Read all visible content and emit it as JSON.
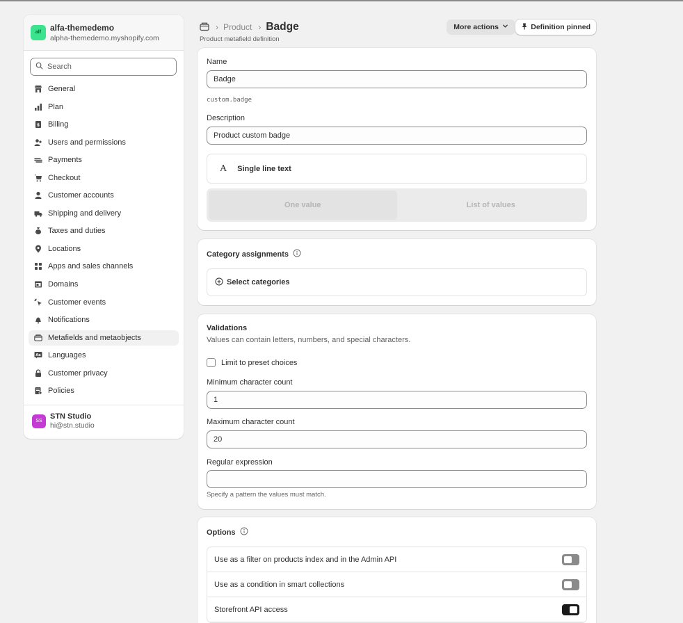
{
  "store": {
    "logo_text": "alf",
    "name": "alfa-themedemo",
    "domain": "alpha-themedemo.myshopify.com"
  },
  "search": {
    "placeholder": "Search"
  },
  "sidebar": {
    "items": [
      {
        "label": "General",
        "icon": "store-icon"
      },
      {
        "label": "Plan",
        "icon": "plan-icon"
      },
      {
        "label": "Billing",
        "icon": "billing-icon"
      },
      {
        "label": "Users and permissions",
        "icon": "users-icon"
      },
      {
        "label": "Payments",
        "icon": "payments-icon"
      },
      {
        "label": "Checkout",
        "icon": "cart-icon"
      },
      {
        "label": "Customer accounts",
        "icon": "person-icon"
      },
      {
        "label": "Shipping and delivery",
        "icon": "truck-icon"
      },
      {
        "label": "Taxes and duties",
        "icon": "tax-icon"
      },
      {
        "label": "Locations",
        "icon": "location-icon"
      },
      {
        "label": "Apps and sales channels",
        "icon": "apps-icon"
      },
      {
        "label": "Domains",
        "icon": "domain-icon"
      },
      {
        "label": "Customer events",
        "icon": "cursor-icon"
      },
      {
        "label": "Notifications",
        "icon": "bell-icon"
      },
      {
        "label": "Metafields and metaobjects",
        "icon": "metafields-icon"
      },
      {
        "label": "Languages",
        "icon": "language-icon"
      },
      {
        "label": "Customer privacy",
        "icon": "lock-icon"
      },
      {
        "label": "Policies",
        "icon": "policy-icon"
      }
    ]
  },
  "user": {
    "initials": "SS",
    "name": "STN Studio",
    "email": "hi@stn.studio"
  },
  "header": {
    "breadcrumb_parent": "Product",
    "title": "Badge",
    "subtitle": "Product metafield definition",
    "more_actions_label": "More actions",
    "pin_label": "Definition pinned"
  },
  "definition": {
    "name_label": "Name",
    "name_value": "Badge",
    "namespace_key": "custom.badge",
    "description_label": "Description",
    "description_value": "Product custom badge",
    "type_glyph": "A",
    "type_label": "Single line text",
    "one_value_label": "One value",
    "list_values_label": "List of values"
  },
  "categories": {
    "title": "Category assignments",
    "select_label": "Select categories"
  },
  "validations": {
    "title": "Validations",
    "description": "Values can contain letters, numbers, and special characters.",
    "preset_label": "Limit to preset choices",
    "min_label": "Minimum character count",
    "min_value": "1",
    "max_label": "Maximum character count",
    "max_value": "20",
    "regex_label": "Regular expression",
    "regex_value": "",
    "regex_hint": "Specify a pattern the values must match."
  },
  "options": {
    "title": "Options",
    "rows": [
      {
        "label": "Use as a filter on products index and in the Admin API",
        "enabled": false
      },
      {
        "label": "Use as a condition in smart collections",
        "enabled": false
      },
      {
        "label": "Storefront API access",
        "enabled": true
      }
    ]
  }
}
